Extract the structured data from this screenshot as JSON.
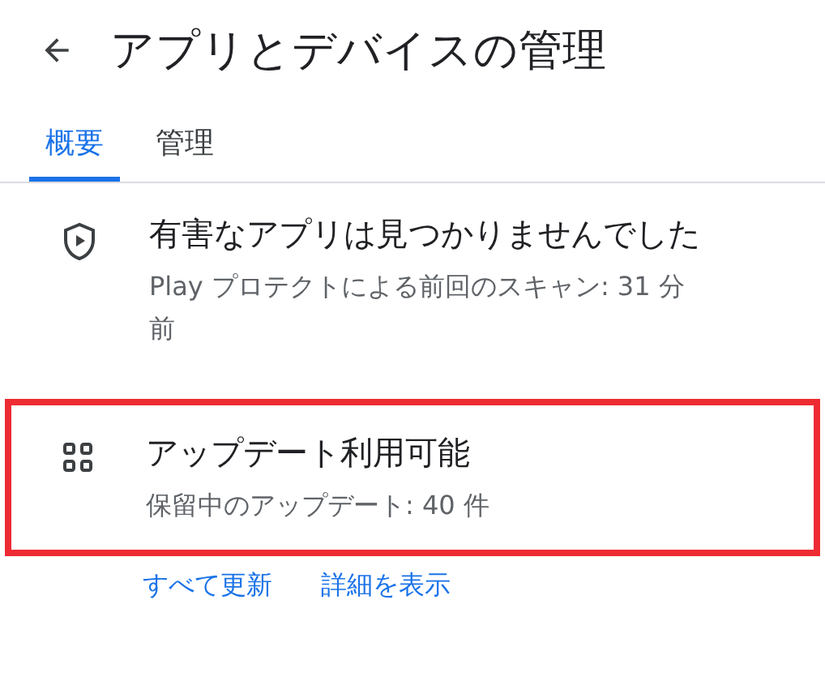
{
  "header": {
    "title": "アプリとデバイスの管理"
  },
  "tabs": [
    {
      "label": "概要",
      "selected": true
    },
    {
      "label": "管理",
      "selected": false
    }
  ],
  "items": [
    {
      "kind": "protect",
      "title": "有害なアプリは見つかりませんでした",
      "subtitle": "Play プロテクトによる前回のスキャン: 31 分前",
      "highlighted": false
    },
    {
      "kind": "updates",
      "title": "アップデート利用可能",
      "subtitle": "保留中のアップデート: 40 件",
      "highlighted": true
    }
  ],
  "links": [
    "すべて更新",
    "詳細を表示"
  ]
}
